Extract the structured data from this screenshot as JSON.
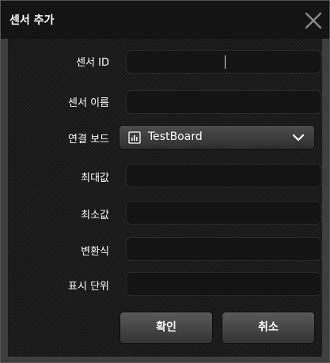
{
  "window": {
    "title": "센서 추가",
    "close_icon": "close-icon"
  },
  "form": {
    "sensor_id_label": "센서 ID",
    "sensor_id_value": "",
    "sensor_name_label": "센서 이름",
    "sensor_name_value": "",
    "board_label": "연결 보드",
    "board_value": "TestBoard",
    "board_icon": "board-icon",
    "max_label": "최대값",
    "max_value": "",
    "min_label": "최소값",
    "min_value": "",
    "formula_label": "변환식",
    "formula_value": "",
    "unit_label": "표시 단위",
    "unit_value": ""
  },
  "buttons": {
    "confirm_label": "확인",
    "cancel_label": "취소"
  },
  "colors": {
    "titlebar": "#141414",
    "frame": "#3f3f3f",
    "panel": "#1c1c1c",
    "field": "#141414",
    "text": "#ffffff"
  }
}
